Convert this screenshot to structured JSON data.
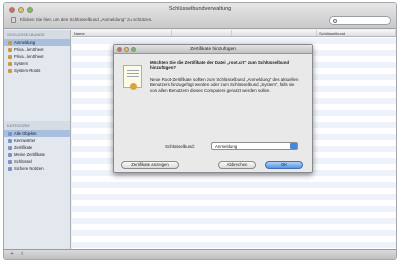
{
  "window": {
    "title": "Schlüsselbundverwaltung",
    "lock_hint": "Klicken Sie hier, um den Schlüsselbund „Anmeldung“ zu schützen."
  },
  "sidebar": {
    "keychains_header": "Schlüsselbunde",
    "keychains": [
      {
        "label": "Anmeldung"
      },
      {
        "label": "Priva...lenSheet"
      },
      {
        "label": "Priva...lenSheet"
      },
      {
        "label": "System"
      },
      {
        "label": "System-Roots"
      }
    ],
    "category_header": "Kategorie",
    "categories": [
      {
        "label": "Alle Objekte"
      },
      {
        "label": "Kennwörter"
      },
      {
        "label": "Zertifikate"
      },
      {
        "label": "Meine Zertifikate"
      },
      {
        "label": "Schlüssel"
      },
      {
        "label": "Sichere Notizen"
      }
    ]
  },
  "table": {
    "columns": [
      "Name",
      "",
      "",
      "Schlüsselbund"
    ]
  },
  "dialog": {
    "title": "Zertifikate hinzufügen",
    "question": "Möchten Sie die Zertifikate der Datei „root.crt“ zum Schlüsselbund hinzufügen?",
    "explanation": "Neue Root-Zertifikate sollten zum Schlüsselbund „Anmeldung“ des aktuellen Benutzers hinzugefügt werden oder zum Schlüsselbund „System“, falls sie von allen Benutzern dieses Computers genutzt werden sollen.",
    "keychain_label": "Schlüsselbund:",
    "keychain_value": "Anmeldung",
    "show_certs_button": "Zertifikate anzeigen",
    "cancel_button": "Abbrechen",
    "ok_button": "OK"
  },
  "bottombar": {
    "add_label": "+",
    "info_label": "i"
  }
}
